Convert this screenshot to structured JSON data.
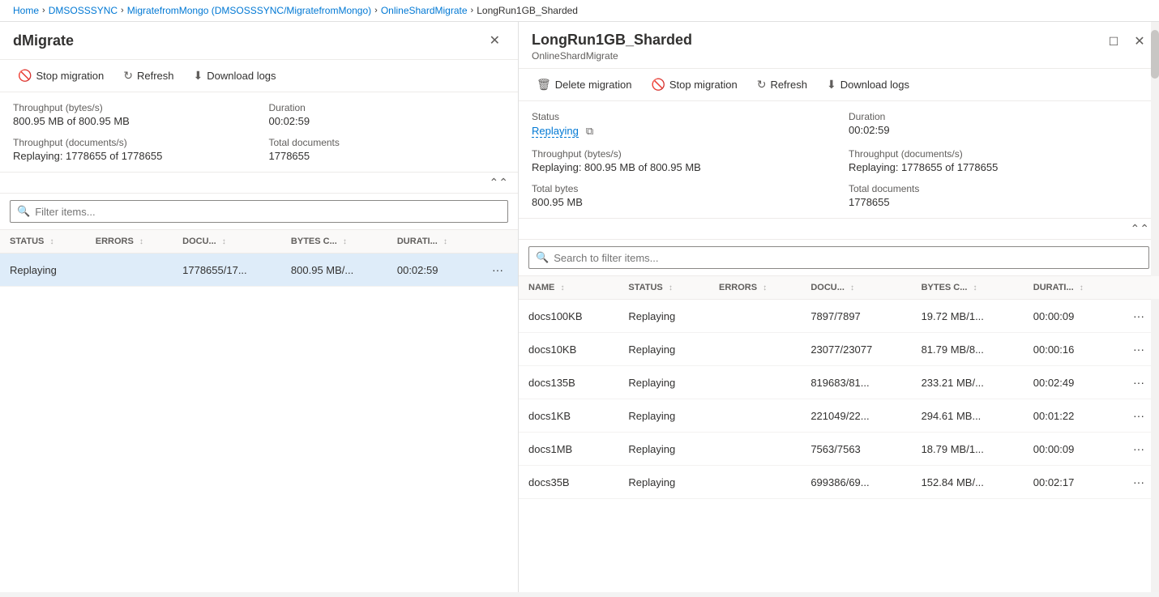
{
  "breadcrumb": {
    "items": [
      "Home",
      "DMSOSSSYNC",
      "MigratefromMongo (DMSOSSSYNC/MigratefromMongo)",
      "OnlineShardMigrate",
      "LongRun1GB_Sharded"
    ],
    "separators": [
      ">",
      ">",
      ">",
      ">"
    ]
  },
  "left_panel": {
    "title": "dMigrate",
    "toolbar": {
      "stop_migration": "Stop migration",
      "refresh": "Refresh",
      "download_logs": "Download logs"
    },
    "stats": {
      "throughput_bytes_label": "Throughput (bytes/s)",
      "throughput_bytes_value": "800.95 MB of 800.95 MB",
      "duration_label": "Duration",
      "duration_value": "00:02:59",
      "throughput_docs_label": "Throughput (documents/s)",
      "throughput_docs_value": "Replaying: 1778655 of 1778655",
      "total_docs_label": "Total documents",
      "total_docs_value": "1778655"
    },
    "search_placeholder": "Filter items...",
    "table": {
      "columns": [
        "STATUS",
        "ERRORS",
        "DOCU...",
        "BYTES C...",
        "DURATI..."
      ],
      "rows": [
        {
          "status": "Replaying",
          "errors": "",
          "documents": "1778655/17...",
          "bytes": "800.95 MB/...",
          "duration": "00:02:59",
          "selected": true
        }
      ]
    }
  },
  "right_panel": {
    "title": "LongRun1GB_Sharded",
    "subtitle": "OnlineShardMigrate",
    "toolbar": {
      "delete_migration": "Delete migration",
      "stop_migration": "Stop migration",
      "refresh": "Refresh",
      "download_logs": "Download logs"
    },
    "stats": {
      "status_label": "Status",
      "status_value": "Replaying",
      "duration_label": "Duration",
      "duration_value": "00:02:59",
      "throughput_bytes_label": "Throughput (bytes/s)",
      "throughput_bytes_value": "Replaying: 800.95 MB of 800.95 MB",
      "throughput_docs_label": "Throughput (documents/s)",
      "throughput_docs_value": "Replaying: 1778655 of 1778655",
      "total_bytes_label": "Total bytes",
      "total_bytes_value": "800.95 MB",
      "total_docs_label": "Total documents",
      "total_docs_value": "1778655"
    },
    "search_placeholder": "Search to filter items...",
    "table": {
      "columns": [
        "NAME",
        "STATUS",
        "ERRORS",
        "DOCU...",
        "BYTES C...",
        "DURATI..."
      ],
      "rows": [
        {
          "name": "docs100KB",
          "status": "Replaying",
          "errors": "",
          "documents": "7897/7897",
          "bytes": "19.72 MB/1...",
          "duration": "00:00:09"
        },
        {
          "name": "docs10KB",
          "status": "Replaying",
          "errors": "",
          "documents": "23077/23077",
          "bytes": "81.79 MB/8...",
          "duration": "00:00:16"
        },
        {
          "name": "docs135B",
          "status": "Replaying",
          "errors": "",
          "documents": "819683/81...",
          "bytes": "233.21 MB/...",
          "duration": "00:02:49"
        },
        {
          "name": "docs1KB",
          "status": "Replaying",
          "errors": "",
          "documents": "221049/22...",
          "bytes": "294.61 MB...",
          "duration": "00:01:22"
        },
        {
          "name": "docs1MB",
          "status": "Replaying",
          "errors": "",
          "documents": "7563/7563",
          "bytes": "18.79 MB/1...",
          "duration": "00:00:09"
        },
        {
          "name": "docs35B",
          "status": "Replaying",
          "errors": "",
          "documents": "699386/69...",
          "bytes": "152.84 MB/...",
          "duration": "00:02:17"
        }
      ]
    }
  },
  "icons": {
    "stop": "🚫",
    "refresh": "↻",
    "download": "⬇",
    "delete": "🗑",
    "search": "🔍",
    "more": "···",
    "collapse": "⌃",
    "close": "✕",
    "maximize": "☐",
    "copy": "⧉",
    "chevron_up": "⌃"
  }
}
